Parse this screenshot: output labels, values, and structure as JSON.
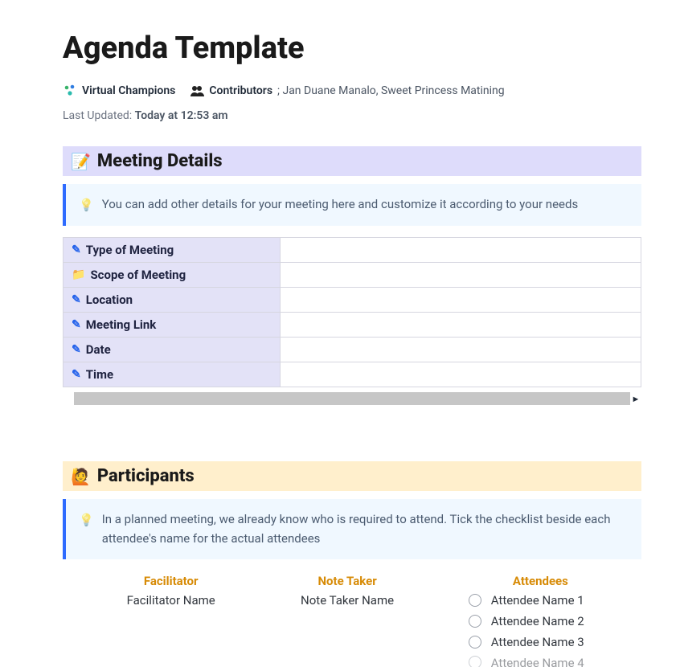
{
  "title": "Agenda Template",
  "meta": {
    "team": "Virtual Champions",
    "contributors_label": "Contributors",
    "contributors": "; Jan Duane Manalo, Sweet Princess Matining",
    "last_updated_label": "Last Updated:",
    "last_updated_value": "Today at 12:53 am"
  },
  "sections": {
    "meeting_details": {
      "heading": "Meeting Details",
      "callout": "You can add other details for your meeting here and customize it according to your needs",
      "rows": [
        {
          "icon": "pencil",
          "label": "Type of Meeting",
          "value": ""
        },
        {
          "icon": "folder",
          "label": "Scope of Meeting",
          "value": ""
        },
        {
          "icon": "pencil",
          "label": "Location",
          "value": ""
        },
        {
          "icon": "pencil",
          "label": "Meeting Link",
          "value": ""
        },
        {
          "icon": "pencil",
          "label": "Date",
          "value": ""
        },
        {
          "icon": "pencil",
          "label": "Time",
          "value": ""
        }
      ]
    },
    "participants": {
      "heading": "Participants",
      "callout": "In a planned meeting, we already know who is required to attend. Tick the checklist beside each attendee's name for the actual attendees",
      "columns": {
        "facilitator": {
          "header": "Facilitator",
          "value": "Facilitator Name"
        },
        "note_taker": {
          "header": "Note Taker",
          "value": "Note Taker Name"
        },
        "attendees": {
          "header": "Attendees",
          "items": [
            "Attendee Name 1",
            "Attendee Name 2",
            "Attendee Name 3",
            "Attendee Name 4"
          ]
        }
      }
    }
  }
}
